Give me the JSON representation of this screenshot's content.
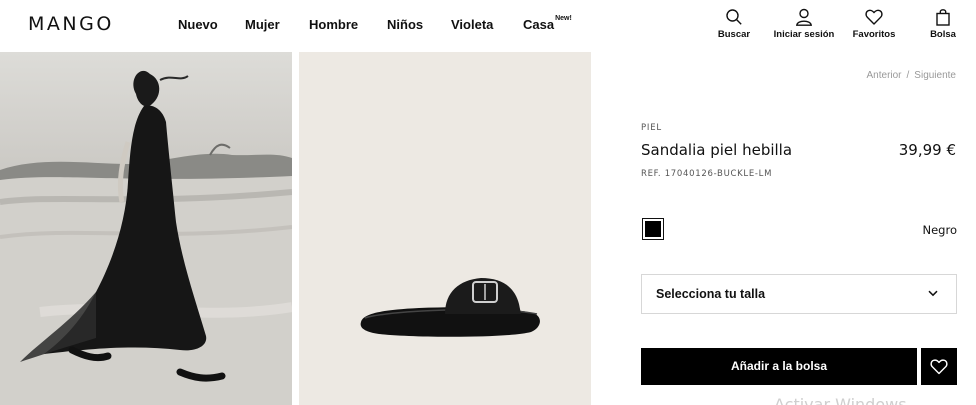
{
  "brand": {
    "logo": "MANGO"
  },
  "nav": {
    "items": [
      {
        "label": "Nuevo"
      },
      {
        "label": "Mujer"
      },
      {
        "label": "Hombre"
      },
      {
        "label": "Niños"
      },
      {
        "label": "Violeta"
      },
      {
        "label": "Casa",
        "badge": "New!"
      }
    ]
  },
  "tools": {
    "search": {
      "label": "Buscar",
      "icon": "search-icon"
    },
    "login": {
      "label": "Iniciar sesión",
      "icon": "user-icon"
    },
    "favorites": {
      "label": "Favoritos",
      "icon": "heart-icon"
    },
    "bag": {
      "label": "Bolsa",
      "icon": "bag-icon"
    }
  },
  "pager": {
    "prev": "Anterior",
    "separator": "/",
    "next": "Siguiente"
  },
  "product": {
    "material": "PIEL",
    "name": "Sandalia piel hebilla",
    "price": "39,99 €",
    "reference": "REF. 17040126-BUCKLE-LM",
    "color": {
      "name": "Negro",
      "swatch": "#000000"
    },
    "size_select": {
      "placeholder": "Selecciona tu talla",
      "icon": "chevron-down-icon"
    },
    "add_to_bag": "Añadir a la bolsa",
    "favorite_icon": "heart-icon"
  },
  "overlay": {
    "watermark": "Activar Windows"
  },
  "colors": {
    "text": "#111111",
    "button": "#000000",
    "button_text": "#ffffff",
    "border": "#d7d7d7",
    "muted": "#999999"
  }
}
